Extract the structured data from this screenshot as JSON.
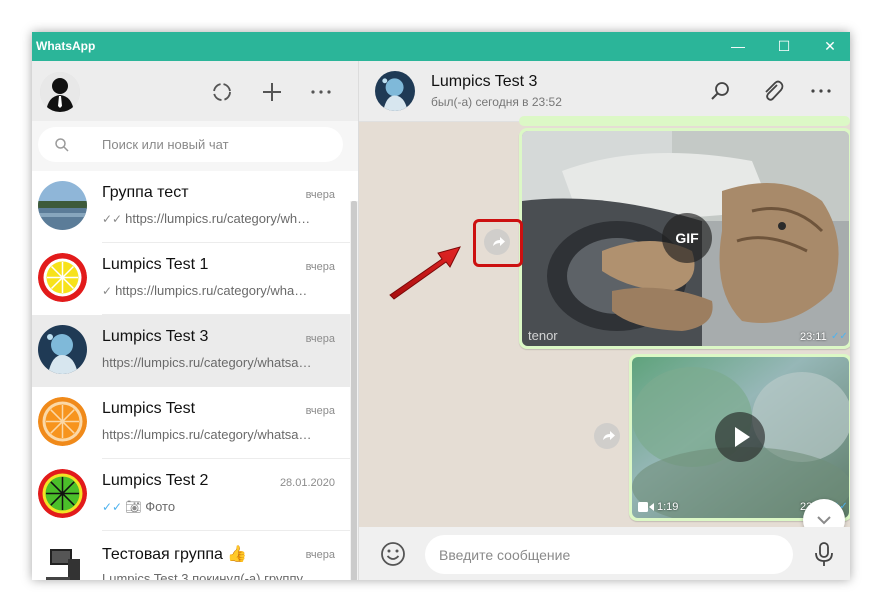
{
  "window": {
    "title": "WhatsApp",
    "controls": {
      "minimize": "—",
      "maximize": "☐",
      "close": "✕"
    }
  },
  "sidebar": {
    "header": {
      "icons": [
        "status-icon",
        "new-chat-icon",
        "menu-icon"
      ]
    },
    "search": {
      "placeholder": "Поиск или новый чат"
    },
    "chats": [
      {
        "name": "Группа тест",
        "time": "вчера",
        "tick": "✓✓",
        "tick_color": "#8a8a8a",
        "preview": "https://lumpics.ru/category/wh…"
      },
      {
        "name": "Lumpics Test 1",
        "time": "вчера",
        "tick": "✓",
        "tick_color": "#8a8a8a",
        "preview": "https://lumpics.ru/category/wha…"
      },
      {
        "name": "Lumpics Test 3",
        "time": "вчера",
        "tick": "",
        "tick_color": "",
        "preview": "https://lumpics.ru/category/whatsa…"
      },
      {
        "name": "Lumpics Test",
        "time": "вчера",
        "tick": "",
        "tick_color": "",
        "preview": "https://lumpics.ru/category/whatsa…"
      },
      {
        "name": "Lumpics Test 2",
        "time": "28.01.2020",
        "tick": "✓✓",
        "tick_color": "#4fb3ee",
        "preview": "Фото"
      },
      {
        "name": "Тестовая группа 👍",
        "time": "вчера",
        "tick": "",
        "tick_color": "",
        "preview": "Lumpics Test 3 покинул(-а) группу"
      }
    ]
  },
  "conversation": {
    "contact_name": "Lumpics Test 3",
    "contact_status": "был(-а) сегодня в 23:52",
    "header_icons": [
      "search-icon",
      "attach-icon",
      "menu-icon"
    ],
    "messages": [
      {
        "type": "gif",
        "badge": "GIF",
        "watermark": "tenor",
        "time": "23:11",
        "ticks": "✓✓"
      },
      {
        "type": "video",
        "duration": "1:19",
        "time": "23:12",
        "ticks": "✓✓"
      }
    ],
    "composer": {
      "placeholder": "Введите сообщение"
    }
  },
  "colors": {
    "titlebar": "#2bb599",
    "bubble": "#dcf8c6",
    "chat_bg": "#e5ddd4",
    "highlight": "#cc1010",
    "read_tick": "#4fb3ee"
  }
}
